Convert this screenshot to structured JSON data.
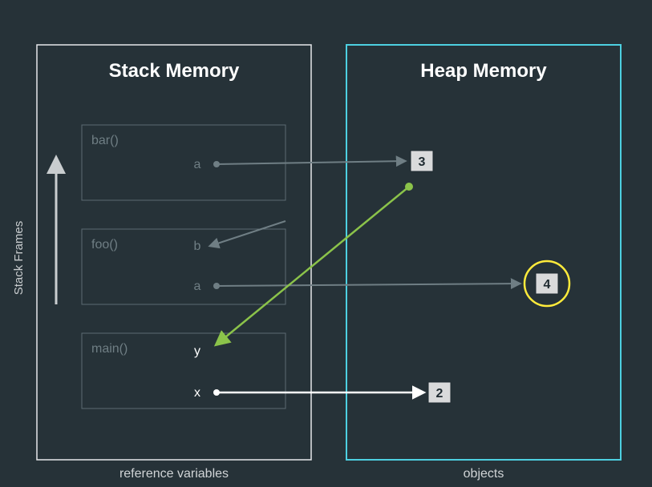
{
  "titles": {
    "stack": "Stack Memory",
    "heap": "Heap Memory"
  },
  "captions": {
    "stack": "reference variables",
    "heap": "objects"
  },
  "axis_label": "Stack Frames",
  "frames": [
    {
      "name": "bar()",
      "vars": [
        {
          "name": "a",
          "dim": true
        }
      ]
    },
    {
      "name": "foo()",
      "vars": [
        {
          "name": "b",
          "dim": true
        },
        {
          "name": "a",
          "dim": true
        }
      ]
    },
    {
      "name": "main()",
      "vars": [
        {
          "name": "y",
          "dim": false
        },
        {
          "name": "x",
          "dim": false
        }
      ]
    }
  ],
  "heap_objects": [
    {
      "id": "obj3",
      "value": "3",
      "highlighted": false
    },
    {
      "id": "obj4",
      "value": "4",
      "highlighted": true
    },
    {
      "id": "obj2",
      "value": "2",
      "highlighted": false
    }
  ],
  "colors": {
    "bg": "#263238",
    "stack_border": "#e6e8ea",
    "heap_border": "#4dd0e1",
    "frame_border": "#5c6b72",
    "active_arrow": "#ffffff",
    "highlight_arrow": "#8bc34a",
    "highlight_ring": "#ffeb3b",
    "dim": "#6f7e84",
    "box_bg": "#d9dadb"
  }
}
